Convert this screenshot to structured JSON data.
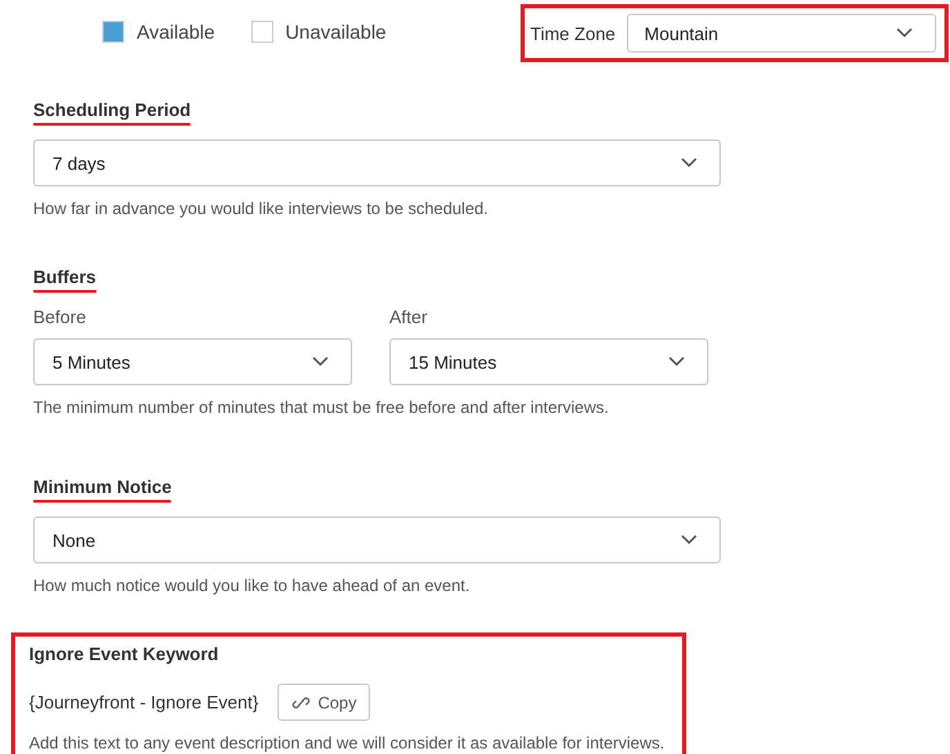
{
  "legend": [
    {
      "label": "Available",
      "color": "#4a9fd5"
    },
    {
      "label": "Unavailable",
      "color": "#ffffff"
    }
  ],
  "time_zone": {
    "label": "Time Zone",
    "value": "Mountain",
    "highlighted": true
  },
  "sections": [
    {
      "kind": "single",
      "title": "Scheduling Period",
      "underlined": true,
      "highlighted": false,
      "value": "7 days",
      "hint": "How far in advance you would like interviews to be scheduled."
    },
    {
      "kind": "pair",
      "title": "Buffers",
      "underlined": true,
      "highlighted": false,
      "fields": [
        {
          "label": "Before",
          "value": "5 Minutes"
        },
        {
          "label": "After",
          "value": "15 Minutes"
        }
      ],
      "hint": "The minimum number of minutes that must be free before and after interviews."
    },
    {
      "kind": "single",
      "title": "Minimum Notice",
      "underlined": true,
      "highlighted": false,
      "value": "None",
      "hint": "How much notice would you like to have ahead of an event."
    },
    {
      "kind": "keyword",
      "title": "Ignore Event Keyword",
      "underlined": false,
      "highlighted": true,
      "keyword": "{Journeyfront - Ignore Event}",
      "button": "Copy",
      "hint": "Add this text to any event description and we will consider it as available for interviews."
    }
  ]
}
